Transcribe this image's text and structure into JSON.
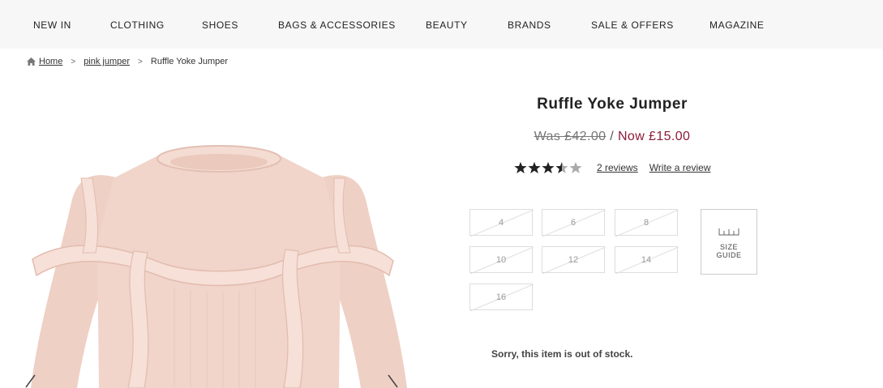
{
  "nav": {
    "items": [
      {
        "label": "NEW IN"
      },
      {
        "label": "CLOTHING"
      },
      {
        "label": "SHOES"
      },
      {
        "label": "BAGS & ACCESSORIES"
      },
      {
        "label": "BEAUTY"
      },
      {
        "label": "BRANDS"
      },
      {
        "label": "SALE & OFFERS"
      },
      {
        "label": "MAGAZINE"
      }
    ]
  },
  "breadcrumb": {
    "home": "Home",
    "category": "pink jumper",
    "current": "Ruffle Yoke Jumper",
    "separator": ">"
  },
  "product": {
    "title": "Ruffle Yoke Jumper",
    "was_price": "Was £42.00",
    "price_separator": " / ",
    "now_price": "Now £15.00",
    "rating": 3.5,
    "rating_max": 5,
    "reviews_link": "2 reviews",
    "write_review_link": "Write a review",
    "sizes": [
      "4",
      "6",
      "8",
      "10",
      "12",
      "14",
      "16"
    ],
    "size_guide_line1": "SIZE",
    "size_guide_line2": "GUIDE",
    "stock_message": "Sorry, this item is out of stock."
  },
  "colors": {
    "nav_bg": "#f7f7f7",
    "sale_price": "#8e1a3a",
    "jumper": "#f0d3c9",
    "star_filled": "#222222",
    "star_empty": "#aaaaaa"
  }
}
